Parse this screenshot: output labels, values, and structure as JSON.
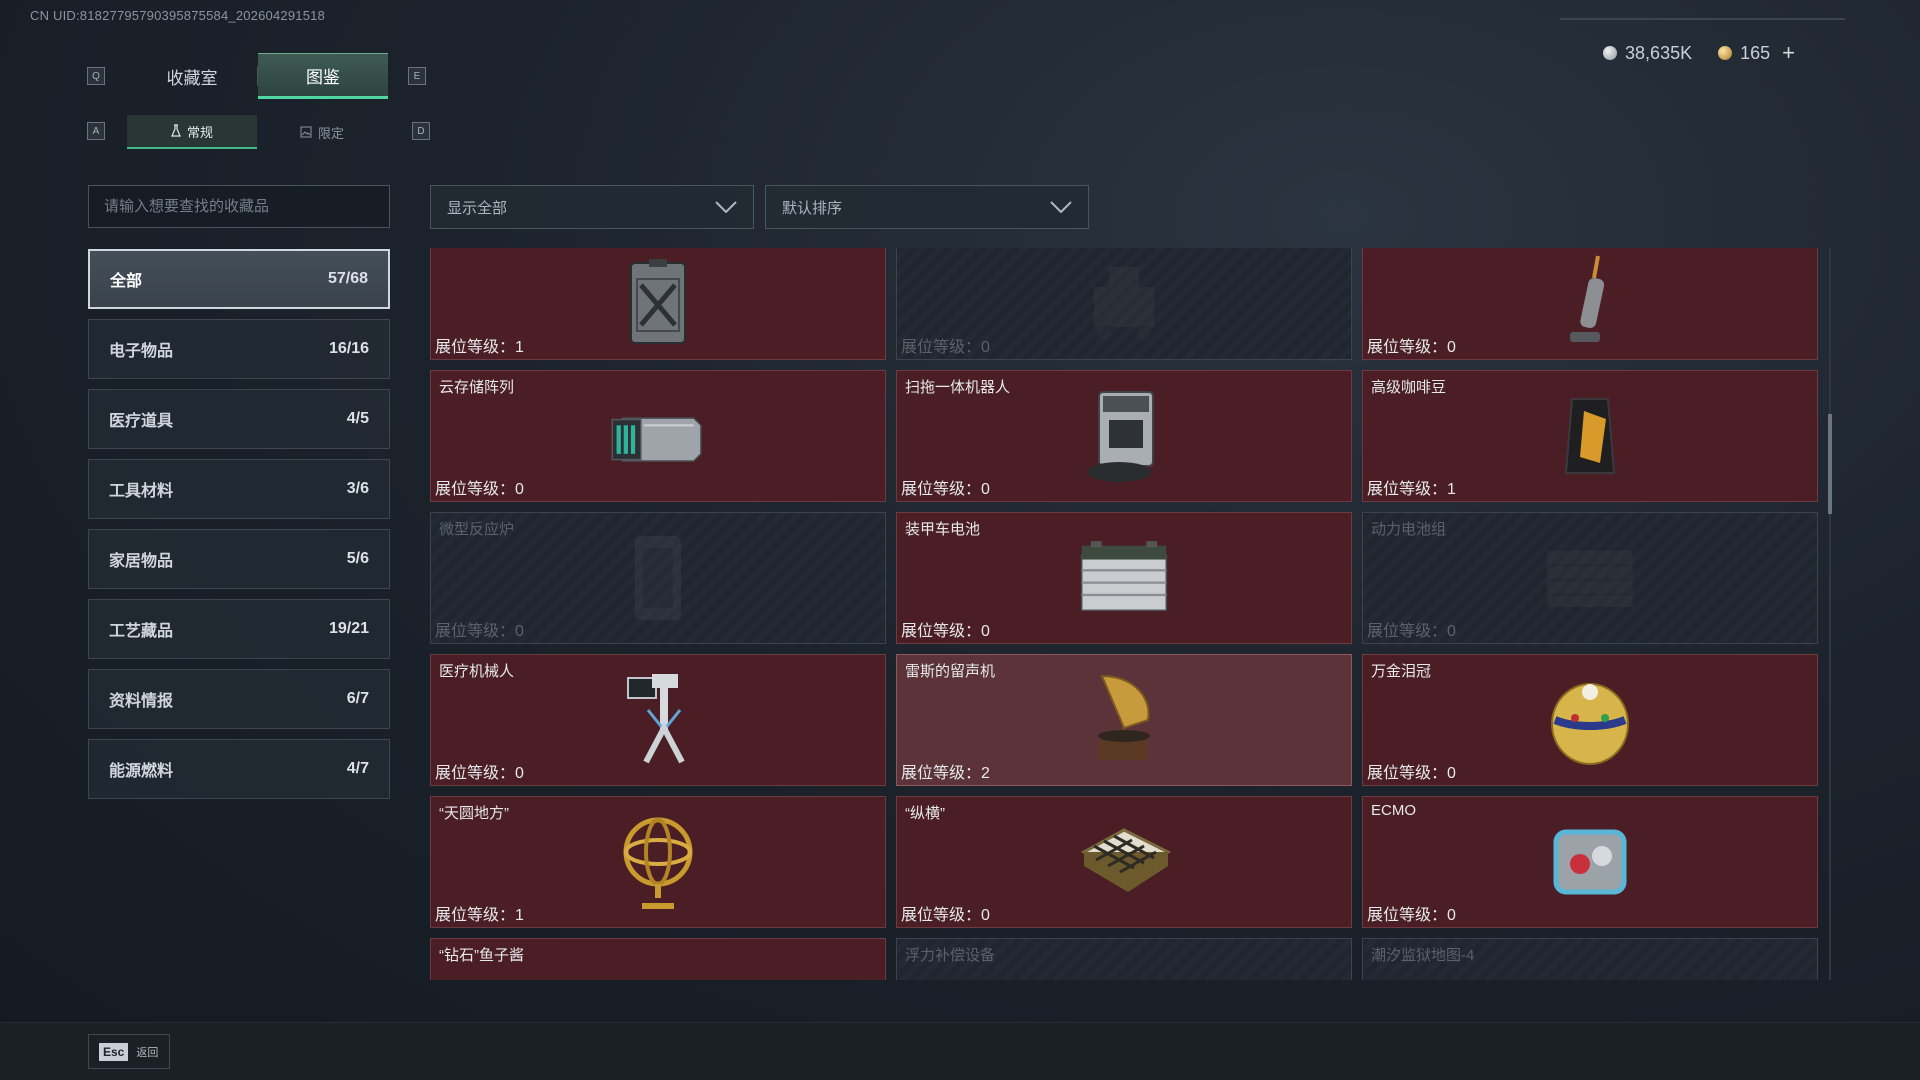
{
  "uid": "CN UID:8182779579039587558­4_202604291518",
  "currency": {
    "silver": "38,635K",
    "gold": "165",
    "plus": "+"
  },
  "keyhints": {
    "q": "Q",
    "e": "E",
    "a": "A",
    "d": "D"
  },
  "tabs": [
    {
      "label": "收藏室",
      "active": false
    },
    {
      "label": "图鉴",
      "active": true
    }
  ],
  "subtabs": [
    {
      "label": "常规",
      "icon": "flask-icon",
      "active": true
    },
    {
      "label": "限定",
      "icon": "image-icon",
      "active": false
    }
  ],
  "search": {
    "placeholder": "请输入想要查找的收藏品",
    "value": ""
  },
  "filters": {
    "show": "显示全部",
    "sort": "默认排序"
  },
  "categories": [
    {
      "label": "全部",
      "count": "57/68",
      "active": true
    },
    {
      "label": "电子物品",
      "count": "16/16"
    },
    {
      "label": "医疗道具",
      "count": "4/5"
    },
    {
      "label": "工具材料",
      "count": "3/6"
    },
    {
      "label": "家居物品",
      "count": "5/6"
    },
    {
      "label": "工艺藏品",
      "count": "19/21"
    },
    {
      "label": "资料情报",
      "count": "6/7"
    },
    {
      "label": "能源燃料",
      "count": "4/7"
    }
  ],
  "level_prefix": "展位等级：",
  "items": [
    {
      "name": "",
      "level": "1",
      "locked": false,
      "icon": "jerrycan-icon"
    },
    {
      "name": "",
      "level": "0",
      "locked": true,
      "icon": "machine-icon"
    },
    {
      "name": "",
      "level": "0",
      "locked": false,
      "icon": "vacuum-icon"
    },
    {
      "name": "云存储阵列",
      "level": "0",
      "locked": false,
      "icon": "server-icon"
    },
    {
      "name": "扫拖一体机器人",
      "level": "0",
      "locked": false,
      "icon": "robot-vacuum-icon"
    },
    {
      "name": "高级咖啡豆",
      "level": "1",
      "locked": false,
      "icon": "coffee-bag-icon"
    },
    {
      "name": "微型反应炉",
      "level": "0",
      "locked": true,
      "icon": "reactor-icon"
    },
    {
      "name": "装甲车电池",
      "level": "0",
      "locked": false,
      "icon": "battery-icon"
    },
    {
      "name": "动力电池组",
      "level": "0",
      "locked": true,
      "icon": "battery-pack-icon"
    },
    {
      "name": "医疗机械人",
      "level": "0",
      "locked": false,
      "icon": "medical-robot-icon"
    },
    {
      "name": "雷斯的留声机",
      "level": "2",
      "locked": false,
      "highlight": true,
      "icon": "gramophone-icon"
    },
    {
      "name": "万金泪冠",
      "level": "0",
      "locked": false,
      "icon": "jeweled-egg-icon"
    },
    {
      "name": "“天圆地方”",
      "level": "1",
      "locked": false,
      "icon": "armillary-sphere-icon"
    },
    {
      "name": "“纵横”",
      "level": "0",
      "locked": false,
      "icon": "chessboard-icon"
    },
    {
      "name": "ECMO",
      "level": "0",
      "locked": false,
      "icon": "ecmo-icon"
    },
    {
      "name": "“钻石”鱼子酱",
      "level": "",
      "locked": false,
      "icon": "caviar-tin-icon"
    },
    {
      "name": "浮力补偿设备",
      "level": "",
      "locked": true,
      "icon": "bcd-icon"
    },
    {
      "name": "潮汐监狱地图-4",
      "level": "",
      "locked": true,
      "icon": "map-icon"
    }
  ],
  "esc": {
    "key": "Esc",
    "label": "返回"
  },
  "colors": {
    "accent": "#4fd7a2",
    "card": "#4a1e24",
    "card_border": "#6b3b40"
  }
}
